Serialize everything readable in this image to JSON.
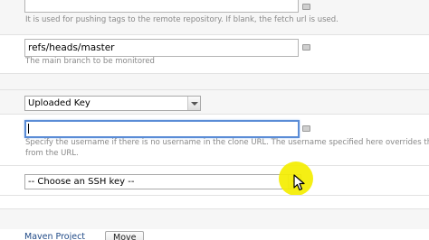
{
  "fields": {
    "fetch_url_help": "It is used for pushing tags to the remote repository. If blank, the fetch url is used.",
    "branch_value": "refs/heads/master",
    "branch_help": "The main branch to be monitored",
    "auth_type_selected": "Uploaded Key",
    "username_value": "",
    "username_help_line1": "Specify the username if there is no username in the clone URL. The username specified here overrides the us",
    "username_help_line2": "from the URL.",
    "ssh_key_selected": "-- Choose an SSH key --"
  },
  "footer": {
    "build_type_link": "Maven Project",
    "move_button": "Move"
  },
  "colors": {
    "highlight": "#f4ee00",
    "focus_border": "#5a8cd6",
    "link": "#204a87"
  },
  "icons": [
    "help-icon",
    "dropdown-arrow-icon",
    "mouse-cursor-icon"
  ]
}
